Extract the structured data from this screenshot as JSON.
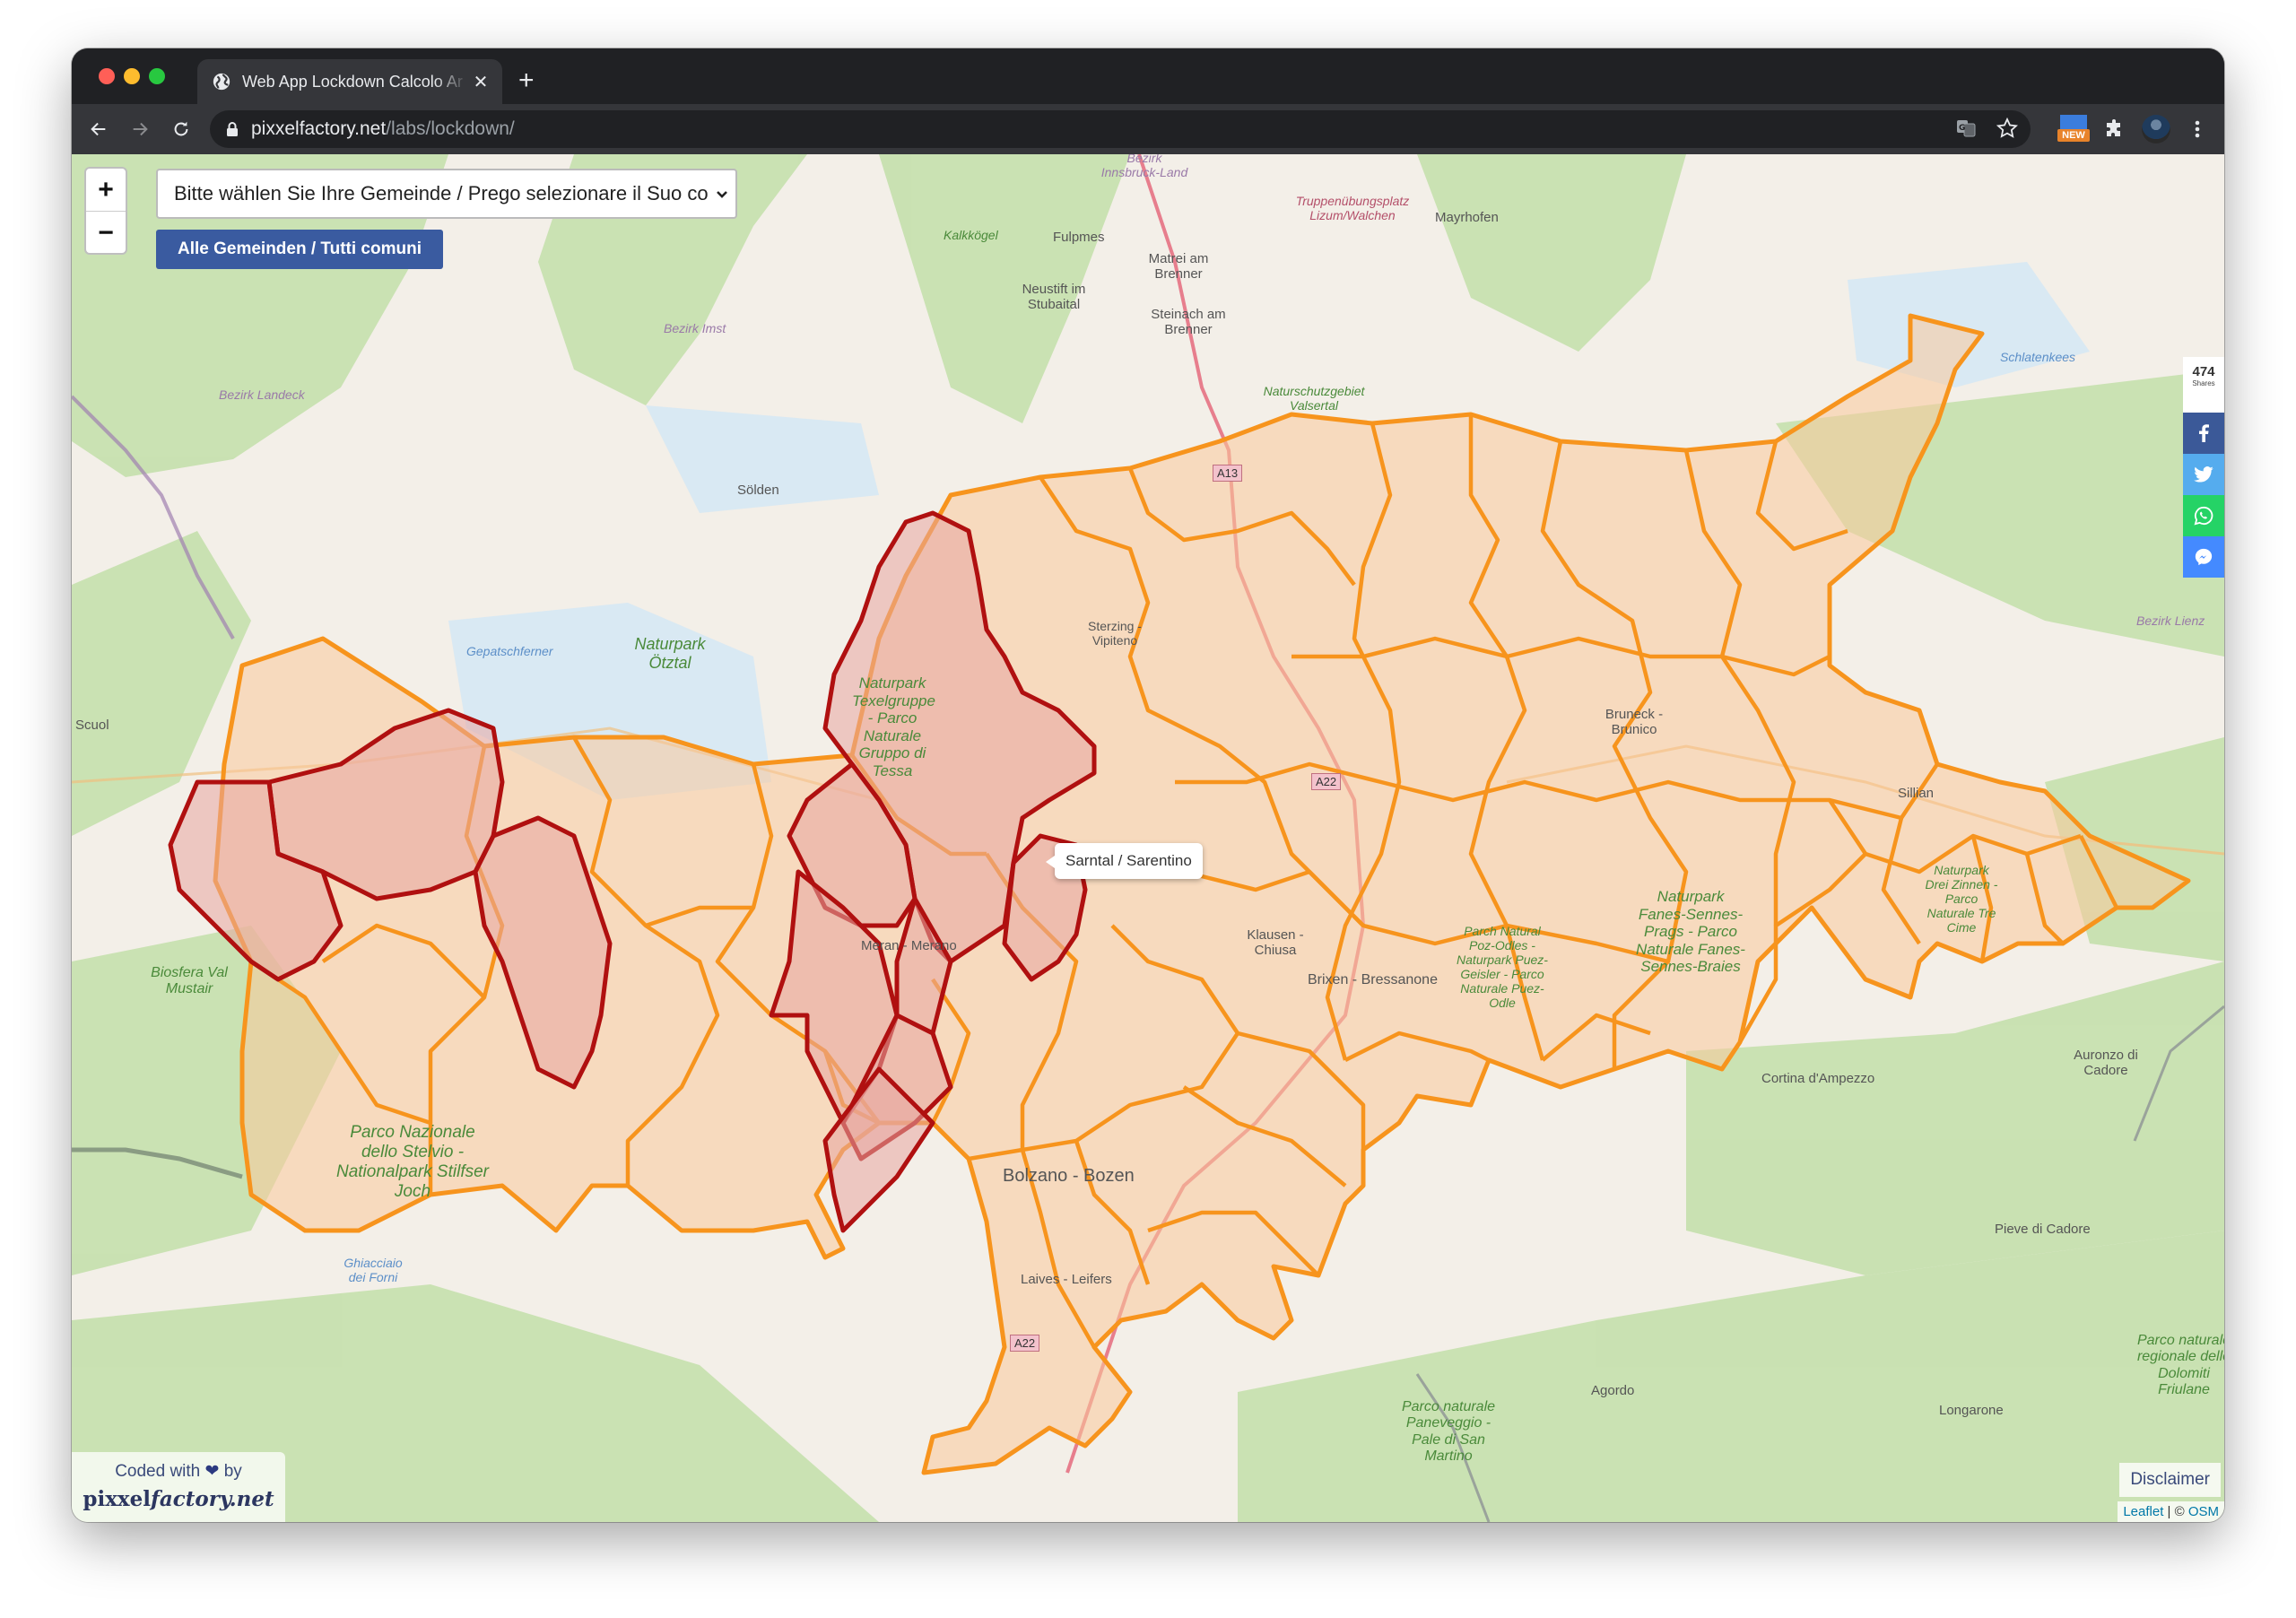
{
  "browser": {
    "tab_title": "Web App Lockdown Calcolo Ar",
    "url_host": "pixxelfactory.net",
    "url_path": "/labs/lockdown/",
    "extension_badge": "NEW"
  },
  "controls": {
    "zoom_in": "+",
    "zoom_out": "−",
    "gemeinde_select_value": "Bitte wählen Sie Ihre Gemeinde / Prego selezionare il Suo comune",
    "all_button": "Alle Gemeinden / Tutti comuni"
  },
  "tooltip": "Sarntal / Sarentino",
  "share": {
    "count": "474",
    "label": "Shares",
    "buttons": [
      "facebook",
      "twitter",
      "whatsapp",
      "messenger"
    ]
  },
  "footer": {
    "credit_line1": "Coded with",
    "credit_line1_end": "by",
    "credit_brand_plain": "pixxel",
    "credit_brand_italic": "factory.net",
    "disclaimer": "Disclaimer",
    "attribution_leaflet": "Leaflet",
    "attribution_sep": " | © ",
    "attribution_osm": "OSM"
  },
  "colors": {
    "boundary_orange": "#f7941d",
    "boundary_red": "#b01010",
    "fill_orange": "#f9c89a",
    "fill_red": "#e8a6a0",
    "button_blue": "#3a5ba0"
  },
  "map_labels": {
    "cities": [
      "Bolzano - Bozen",
      "Brixen - Bressanone",
      "Bruneck - Brunico",
      "Meran - Merano",
      "Sterzing - Vipiteno",
      "Klausen - Chiusa",
      "Laives - Leifers",
      "Sölden",
      "Scuol",
      "Sillian",
      "Fulpmes",
      "Matrei am Brenner",
      "Steinach am Brenner",
      "Neustift im Stubaital",
      "Mayrhofen",
      "Matrei",
      "Cortina d'Ampezzo",
      "Auronzo di Cadore",
      "Pieve di Cadore",
      "Agordo",
      "Longarone"
    ],
    "parks": [
      "Naturpark Ötztal",
      "Naturpark Texelgruppe - Parco Naturale Gruppo di Tessa",
      "Biosfera Val Mustair",
      "Parco Nazionale dello Stelvio - Nationalpark Stilfser Joch",
      "Naturpark Fanes-Sennes-Prags - Parco Naturale Fanes-Sennes-Braies",
      "Parch Natural Poz-Odles - Naturpark Puez-Geisler - Parco Naturale Puez-Odle",
      "Naturpark Drei Zinnen - Parco Naturale Tre Cime",
      "Naturschutzgebiet Valsertal",
      "Kalkkögel",
      "Parco naturale Paneveggio - Pale di San Martino",
      "Parco naturale regionale delle Dolomiti Friulane"
    ],
    "districts": [
      "Bezirk Landeck",
      "Bezirk Imst",
      "Bezirk Innsbruck-Land",
      "Bezirk Lienz"
    ],
    "military": "Truppenübungsplatz Lizum/Walchen",
    "glaciers": [
      "Gepatschferner",
      "Schlatenkees",
      "Ghiacciaio dei Forni"
    ],
    "roads": [
      "A13",
      "A22",
      "A22"
    ]
  }
}
